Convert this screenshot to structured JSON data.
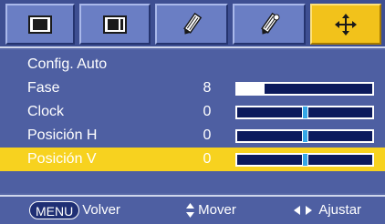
{
  "tabs": [
    {
      "name": "picture-tab",
      "icon": "picture-icon",
      "active": false
    },
    {
      "name": "screen-tab",
      "icon": "screen-icon",
      "active": false
    },
    {
      "name": "function-tab",
      "icon": "pencil-icon",
      "active": false
    },
    {
      "name": "options-tab",
      "icon": "pencil-options-icon",
      "active": false
    },
    {
      "name": "position-tab",
      "icon": "move-arrows-icon",
      "active": true
    }
  ],
  "menu": {
    "auto_config": "Config. Auto",
    "items": [
      {
        "label": "Fase",
        "value": "8",
        "level_fraction": 0.2,
        "display": "fill"
      },
      {
        "label": "Clock",
        "value": "0",
        "level_fraction": 0.5,
        "display": "marker"
      },
      {
        "label": "Posición H",
        "value": "0",
        "level_fraction": 0.5,
        "display": "marker"
      },
      {
        "label": "Posición V",
        "value": "0",
        "level_fraction": 0.5,
        "display": "marker",
        "selected": true
      }
    ]
  },
  "footer": {
    "menu_key": "MENU",
    "back_label": "Volver",
    "move_label": "Mover",
    "adjust_label": "Ajustar"
  },
  "colors": {
    "accent_selected": "#f7d21f",
    "background": "#4e5fa2",
    "bar_track": "#0c1a5c",
    "bar_marker": "#35a7e6"
  }
}
